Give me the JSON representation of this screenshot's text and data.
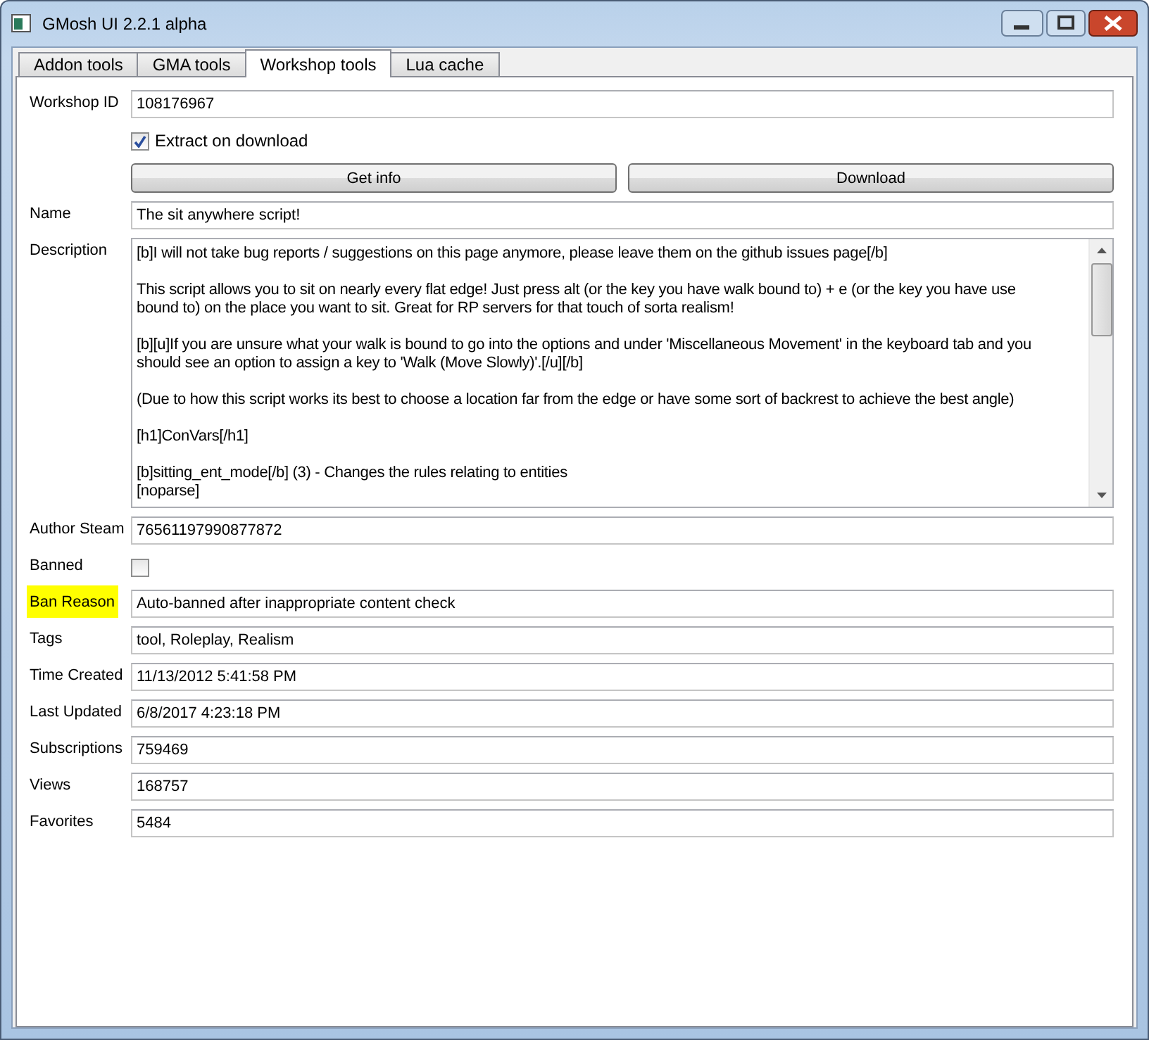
{
  "window": {
    "title": "GMosh UI 2.2.1 alpha"
  },
  "tabs": [
    {
      "label": "Addon tools",
      "selected": false
    },
    {
      "label": "GMA tools",
      "selected": false
    },
    {
      "label": "Workshop tools",
      "selected": true
    },
    {
      "label": "Lua cache",
      "selected": false
    }
  ],
  "workshop_id": {
    "label": "Workshop ID",
    "value": "108176967"
  },
  "extract_on_download": {
    "label": "Extract on download",
    "checked": true
  },
  "buttons": [
    "Get info",
    "Download"
  ],
  "name": {
    "label": "Name",
    "value": "The sit anywhere script!",
    "highlighted": false
  },
  "description": {
    "label": "Description",
    "paragraphs": [
      {
        "lines": [
          "[b]I will not take bug reports / suggestions on this page anymore, please leave them on the github issues page[/b]"
        ]
      },
      {
        "lines": [
          "This script allows you to sit on nearly every flat edge! Just press alt (or the key you have walk bound to) + e (or the key you have use",
          "bound to) on the place you want to sit. Great for RP servers for that touch of sorta realism!"
        ]
      },
      {
        "lines": [
          "[b][u]If you are unsure what your walk is bound to go into the options and under 'Miscellaneous Movement' in the keyboard tab and you",
          "should see an option to assign a key to 'Walk (Move Slowly)'.[/u][/b]"
        ]
      },
      {
        "lines": [
          "(Due to how this script works its best to choose a location far from the edge or have some sort of backrest to achieve the best angle)"
        ]
      },
      {
        "lines": [
          "[h1]ConVars[/h1]"
        ]
      },
      {
        "lines": [
          "[b]sitting_ent_mode[/b] (3) - Changes the rules relating to entities",
          "[noparse]"
        ]
      }
    ]
  },
  "author_steam": {
    "label": "Author Steam",
    "value": "76561197990877872",
    "highlighted": false
  },
  "banned": {
    "label": "Banned",
    "checked": false
  },
  "details": [
    {
      "label": "Ban Reason",
      "value": "Auto-banned after inappropriate content check",
      "highlighted": true
    },
    {
      "label": "Tags",
      "value": "tool, Roleplay, Realism",
      "highlighted": false
    },
    {
      "label": "Time Created",
      "value": "11/13/2012 5:41:58 PM",
      "highlighted": false
    },
    {
      "label": "Last Updated",
      "value": "6/8/2017 4:23:18 PM",
      "highlighted": false
    },
    {
      "label": "Subscriptions",
      "value": "759469",
      "highlighted": false
    },
    {
      "label": "Views",
      "value": "168757",
      "highlighted": false
    },
    {
      "label": "Favorites",
      "value": "5484",
      "highlighted": false
    }
  ]
}
